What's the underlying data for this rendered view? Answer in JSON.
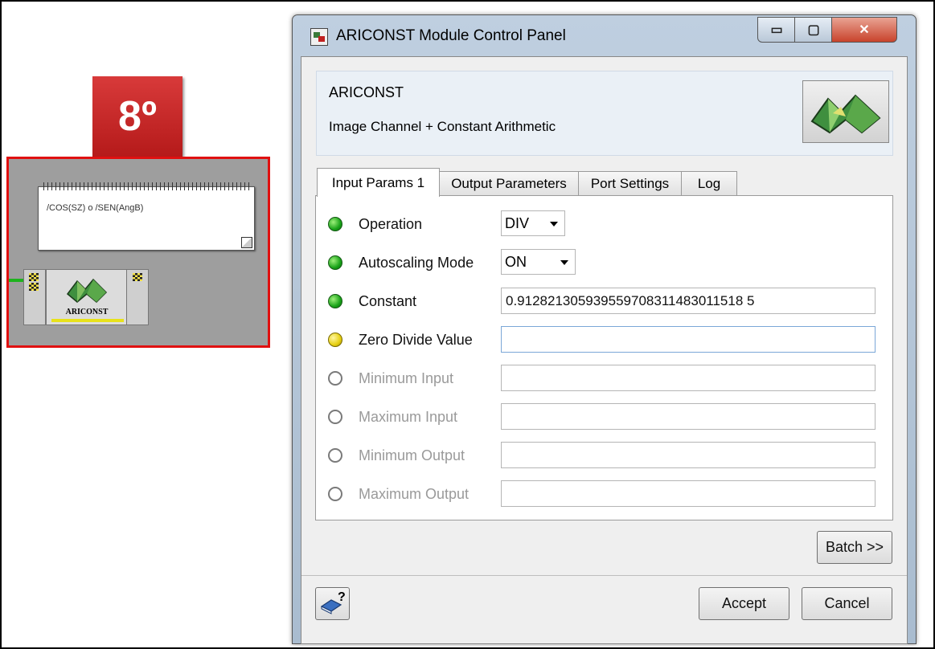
{
  "step_badge": "8º",
  "workspace": {
    "note_text": "/COS(SZ) o /SEN(AngB)",
    "module_label": "ARICONST"
  },
  "window": {
    "title": "ARICONST Module Control Panel",
    "min_glyph": "▭",
    "max_glyph": "▢",
    "close_glyph": "✕"
  },
  "header": {
    "module_name": "ARICONST",
    "module_desc": "Image Channel + Constant Arithmetic"
  },
  "tabs": [
    {
      "label": "Input Params 1"
    },
    {
      "label": "Output Parameters"
    },
    {
      "label": "Port Settings"
    },
    {
      "label": "Log"
    }
  ],
  "params": [
    {
      "label": "Operation",
      "status": "green",
      "value": "DIV"
    },
    {
      "label": "Autoscaling Mode",
      "status": "green",
      "value": "ON"
    },
    {
      "label": "Constant",
      "status": "green",
      "value": "0.912821305939559708311483011518 5"
    },
    {
      "label": "Zero Divide Value",
      "status": "yellow",
      "value": ""
    },
    {
      "label": "Minimum Input",
      "status": "off",
      "value": ""
    },
    {
      "label": "Maximum Input",
      "status": "off",
      "value": ""
    },
    {
      "label": "Minimum Output",
      "status": "off",
      "value": ""
    },
    {
      "label": "Maximum Output",
      "status": "off",
      "value": ""
    }
  ],
  "buttons": {
    "batch": "Batch >>",
    "accept": "Accept",
    "cancel": "Cancel",
    "help_glyph": "?"
  },
  "colors": {
    "badge": "#c62828",
    "canvas_border": "#e01010",
    "status_green": "#18a218",
    "status_yellow": "#e6cf10"
  }
}
